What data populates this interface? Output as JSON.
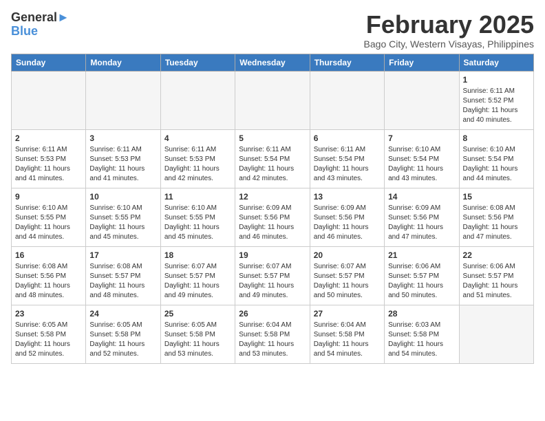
{
  "header": {
    "logo_line1": "General",
    "logo_line2": "Blue",
    "month_title": "February 2025",
    "location": "Bago City, Western Visayas, Philippines"
  },
  "weekdays": [
    "Sunday",
    "Monday",
    "Tuesday",
    "Wednesday",
    "Thursday",
    "Friday",
    "Saturday"
  ],
  "weeks": [
    [
      {
        "day": "",
        "info": ""
      },
      {
        "day": "",
        "info": ""
      },
      {
        "day": "",
        "info": ""
      },
      {
        "day": "",
        "info": ""
      },
      {
        "day": "",
        "info": ""
      },
      {
        "day": "",
        "info": ""
      },
      {
        "day": "1",
        "info": "Sunrise: 6:11 AM\nSunset: 5:52 PM\nDaylight: 11 hours and 40 minutes."
      }
    ],
    [
      {
        "day": "2",
        "info": "Sunrise: 6:11 AM\nSunset: 5:53 PM\nDaylight: 11 hours and 41 minutes."
      },
      {
        "day": "3",
        "info": "Sunrise: 6:11 AM\nSunset: 5:53 PM\nDaylight: 11 hours and 41 minutes."
      },
      {
        "day": "4",
        "info": "Sunrise: 6:11 AM\nSunset: 5:53 PM\nDaylight: 11 hours and 42 minutes."
      },
      {
        "day": "5",
        "info": "Sunrise: 6:11 AM\nSunset: 5:54 PM\nDaylight: 11 hours and 42 minutes."
      },
      {
        "day": "6",
        "info": "Sunrise: 6:11 AM\nSunset: 5:54 PM\nDaylight: 11 hours and 43 minutes."
      },
      {
        "day": "7",
        "info": "Sunrise: 6:10 AM\nSunset: 5:54 PM\nDaylight: 11 hours and 43 minutes."
      },
      {
        "day": "8",
        "info": "Sunrise: 6:10 AM\nSunset: 5:54 PM\nDaylight: 11 hours and 44 minutes."
      }
    ],
    [
      {
        "day": "9",
        "info": "Sunrise: 6:10 AM\nSunset: 5:55 PM\nDaylight: 11 hours and 44 minutes."
      },
      {
        "day": "10",
        "info": "Sunrise: 6:10 AM\nSunset: 5:55 PM\nDaylight: 11 hours and 45 minutes."
      },
      {
        "day": "11",
        "info": "Sunrise: 6:10 AM\nSunset: 5:55 PM\nDaylight: 11 hours and 45 minutes."
      },
      {
        "day": "12",
        "info": "Sunrise: 6:09 AM\nSunset: 5:56 PM\nDaylight: 11 hours and 46 minutes."
      },
      {
        "day": "13",
        "info": "Sunrise: 6:09 AM\nSunset: 5:56 PM\nDaylight: 11 hours and 46 minutes."
      },
      {
        "day": "14",
        "info": "Sunrise: 6:09 AM\nSunset: 5:56 PM\nDaylight: 11 hours and 47 minutes."
      },
      {
        "day": "15",
        "info": "Sunrise: 6:08 AM\nSunset: 5:56 PM\nDaylight: 11 hours and 47 minutes."
      }
    ],
    [
      {
        "day": "16",
        "info": "Sunrise: 6:08 AM\nSunset: 5:56 PM\nDaylight: 11 hours and 48 minutes."
      },
      {
        "day": "17",
        "info": "Sunrise: 6:08 AM\nSunset: 5:57 PM\nDaylight: 11 hours and 48 minutes."
      },
      {
        "day": "18",
        "info": "Sunrise: 6:07 AM\nSunset: 5:57 PM\nDaylight: 11 hours and 49 minutes."
      },
      {
        "day": "19",
        "info": "Sunrise: 6:07 AM\nSunset: 5:57 PM\nDaylight: 11 hours and 49 minutes."
      },
      {
        "day": "20",
        "info": "Sunrise: 6:07 AM\nSunset: 5:57 PM\nDaylight: 11 hours and 50 minutes."
      },
      {
        "day": "21",
        "info": "Sunrise: 6:06 AM\nSunset: 5:57 PM\nDaylight: 11 hours and 50 minutes."
      },
      {
        "day": "22",
        "info": "Sunrise: 6:06 AM\nSunset: 5:57 PM\nDaylight: 11 hours and 51 minutes."
      }
    ],
    [
      {
        "day": "23",
        "info": "Sunrise: 6:05 AM\nSunset: 5:58 PM\nDaylight: 11 hours and 52 minutes."
      },
      {
        "day": "24",
        "info": "Sunrise: 6:05 AM\nSunset: 5:58 PM\nDaylight: 11 hours and 52 minutes."
      },
      {
        "day": "25",
        "info": "Sunrise: 6:05 AM\nSunset: 5:58 PM\nDaylight: 11 hours and 53 minutes."
      },
      {
        "day": "26",
        "info": "Sunrise: 6:04 AM\nSunset: 5:58 PM\nDaylight: 11 hours and 53 minutes."
      },
      {
        "day": "27",
        "info": "Sunrise: 6:04 AM\nSunset: 5:58 PM\nDaylight: 11 hours and 54 minutes."
      },
      {
        "day": "28",
        "info": "Sunrise: 6:03 AM\nSunset: 5:58 PM\nDaylight: 11 hours and 54 minutes."
      },
      {
        "day": "",
        "info": ""
      }
    ]
  ]
}
